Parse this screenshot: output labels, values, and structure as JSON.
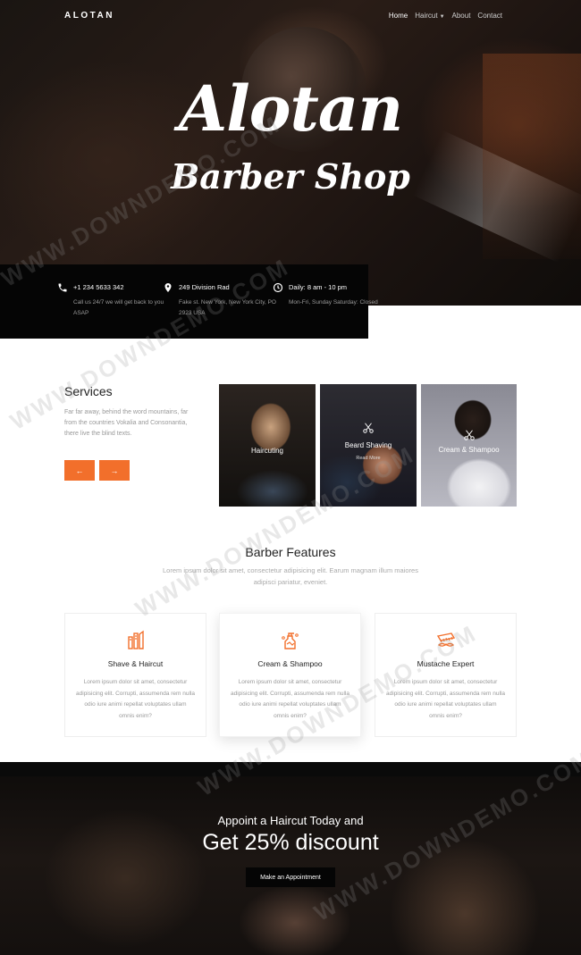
{
  "header": {
    "brand": "ALOTAN",
    "nav": [
      {
        "label": "Home",
        "active": true
      },
      {
        "label": "Haircut",
        "dropdown": true
      },
      {
        "label": "About"
      },
      {
        "label": "Contact"
      }
    ]
  },
  "hero": {
    "title_line1": "Alotan",
    "title_line2": "Barber Shop"
  },
  "info_bar": [
    {
      "icon": "phone-icon",
      "title": "+1 234 5633 342",
      "desc": "Call us 24/7 we will get back to you ASAP"
    },
    {
      "icon": "location-pin-icon",
      "title": "249 Division Rad",
      "desc": "Fake st. New York, New York City, PO 2923 USA"
    },
    {
      "icon": "clock-icon",
      "title": "Daily: 8 am - 10 pm",
      "desc": "Mon-Fri, Sunday Saturday: Closed"
    }
  ],
  "services": {
    "title": "Services",
    "text": "Far far away, behind the word mountains, far from the countries Vokalia and Consonantia, there live the blind texts.",
    "prev_arrow": "←",
    "next_arrow": "→",
    "cards": [
      {
        "label": "Haircuting",
        "sub": ""
      },
      {
        "label": "Beard Shaving",
        "sub": "Read More"
      },
      {
        "label": "Cream & Shampoo",
        "sub": ""
      }
    ]
  },
  "features": {
    "title": "Barber Features",
    "subtitle": "Lorem ipsum dolor sit amet, consectetur adipisicing elit. Earum magnam illum maiores adipisci pariatur, eveniet.",
    "items": [
      {
        "icon": "shave-tools-icon",
        "title": "Shave & Haircut",
        "desc": "Lorem ipsum dolor sit amet, consectetur adipisicing elit. Corrupti, assumenda rem nulla odio iure animi repellat voluptates ullam omnis enim?"
      },
      {
        "icon": "shampoo-bottle-icon",
        "title": "Cream & Shampoo",
        "desc": "Lorem ipsum dolor sit amet, consectetur adipisicing elit. Corrupti, assumenda rem nulla odio iure animi repellat voluptates ullam omnis enim?"
      },
      {
        "icon": "mustache-comb-icon",
        "title": "Mustache Expert",
        "desc": "Lorem ipsum dolor sit amet, consectetur adipisicing elit. Corrupti, assumenda rem nulla odio iure animi repellat voluptates ullam omnis enim?"
      }
    ]
  },
  "cta": {
    "line1": "Appoint a Haircut Today and",
    "line2": "Get 25% discount",
    "button": "Make an Appointment"
  },
  "colors": {
    "accent": "#f26f2b",
    "dark": "#050505"
  },
  "watermark": "WWW.DOWNDEMO.COM"
}
